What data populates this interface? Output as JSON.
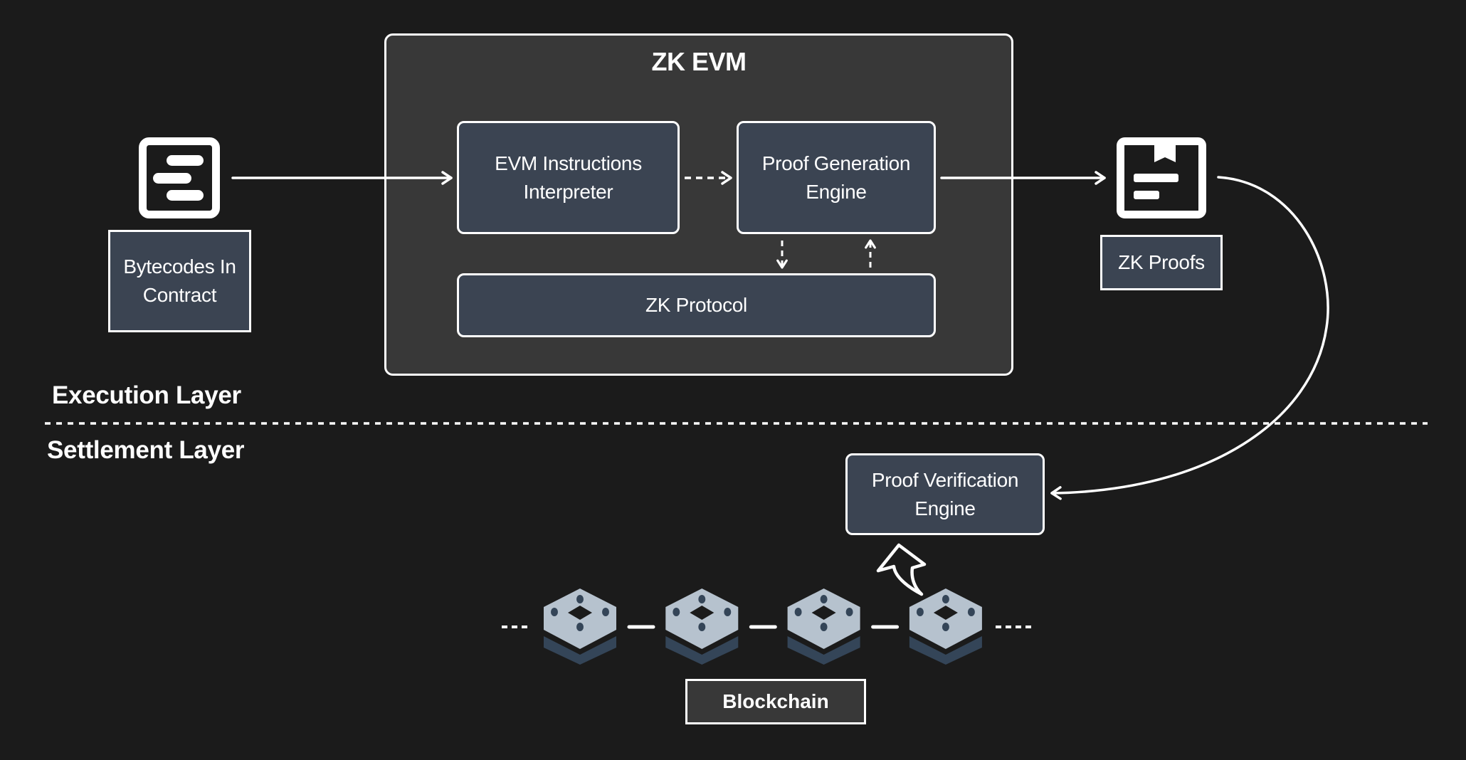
{
  "diagram": {
    "title": "ZK EVM",
    "nodes": {
      "bytecodes": "Bytecodes In\nContract",
      "evm_interpreter": "EVM Instructions\nInterpreter",
      "proof_generation": "Proof Generation\nEngine",
      "zk_protocol": "ZK Protocol",
      "zk_proofs": "ZK Proofs",
      "proof_verification": "Proof Verification\nEngine",
      "blockchain": "Blockchain"
    },
    "layers": {
      "execution": "Execution Layer",
      "settlement": "Settlement Layer"
    },
    "icons": {
      "bytecodes": "document-lines-icon",
      "zk_proofs": "bookmarked-document-icon",
      "block": "blockchain-block-icon",
      "curved_arrow": "curved-up-arrow-icon"
    },
    "blocks_count": 4,
    "edges": [
      {
        "from": "Bytecodes In Contract",
        "to": "EVM Instructions Interpreter",
        "style": "solid"
      },
      {
        "from": "EVM Instructions Interpreter",
        "to": "Proof Generation Engine",
        "style": "dashed"
      },
      {
        "from": "Proof Generation Engine",
        "to": "ZK Protocol",
        "style": "dashed"
      },
      {
        "from": "ZK Protocol",
        "to": "Proof Generation Engine",
        "style": "dashed"
      },
      {
        "from": "Proof Generation Engine",
        "to": "ZK Proofs",
        "style": "solid"
      },
      {
        "from": "ZK Proofs",
        "to": "Proof Verification Engine",
        "style": "solid-curve"
      },
      {
        "from": "Blockchain",
        "to": "Proof Verification Engine",
        "style": "block-arrow"
      }
    ],
    "colors": {
      "background": "#1b1b1b",
      "container": "#383838",
      "node_fill": "#3b4452",
      "block_top": "#b6c2ce",
      "block_shadow": "#344558",
      "stroke": "#ffffff"
    }
  }
}
